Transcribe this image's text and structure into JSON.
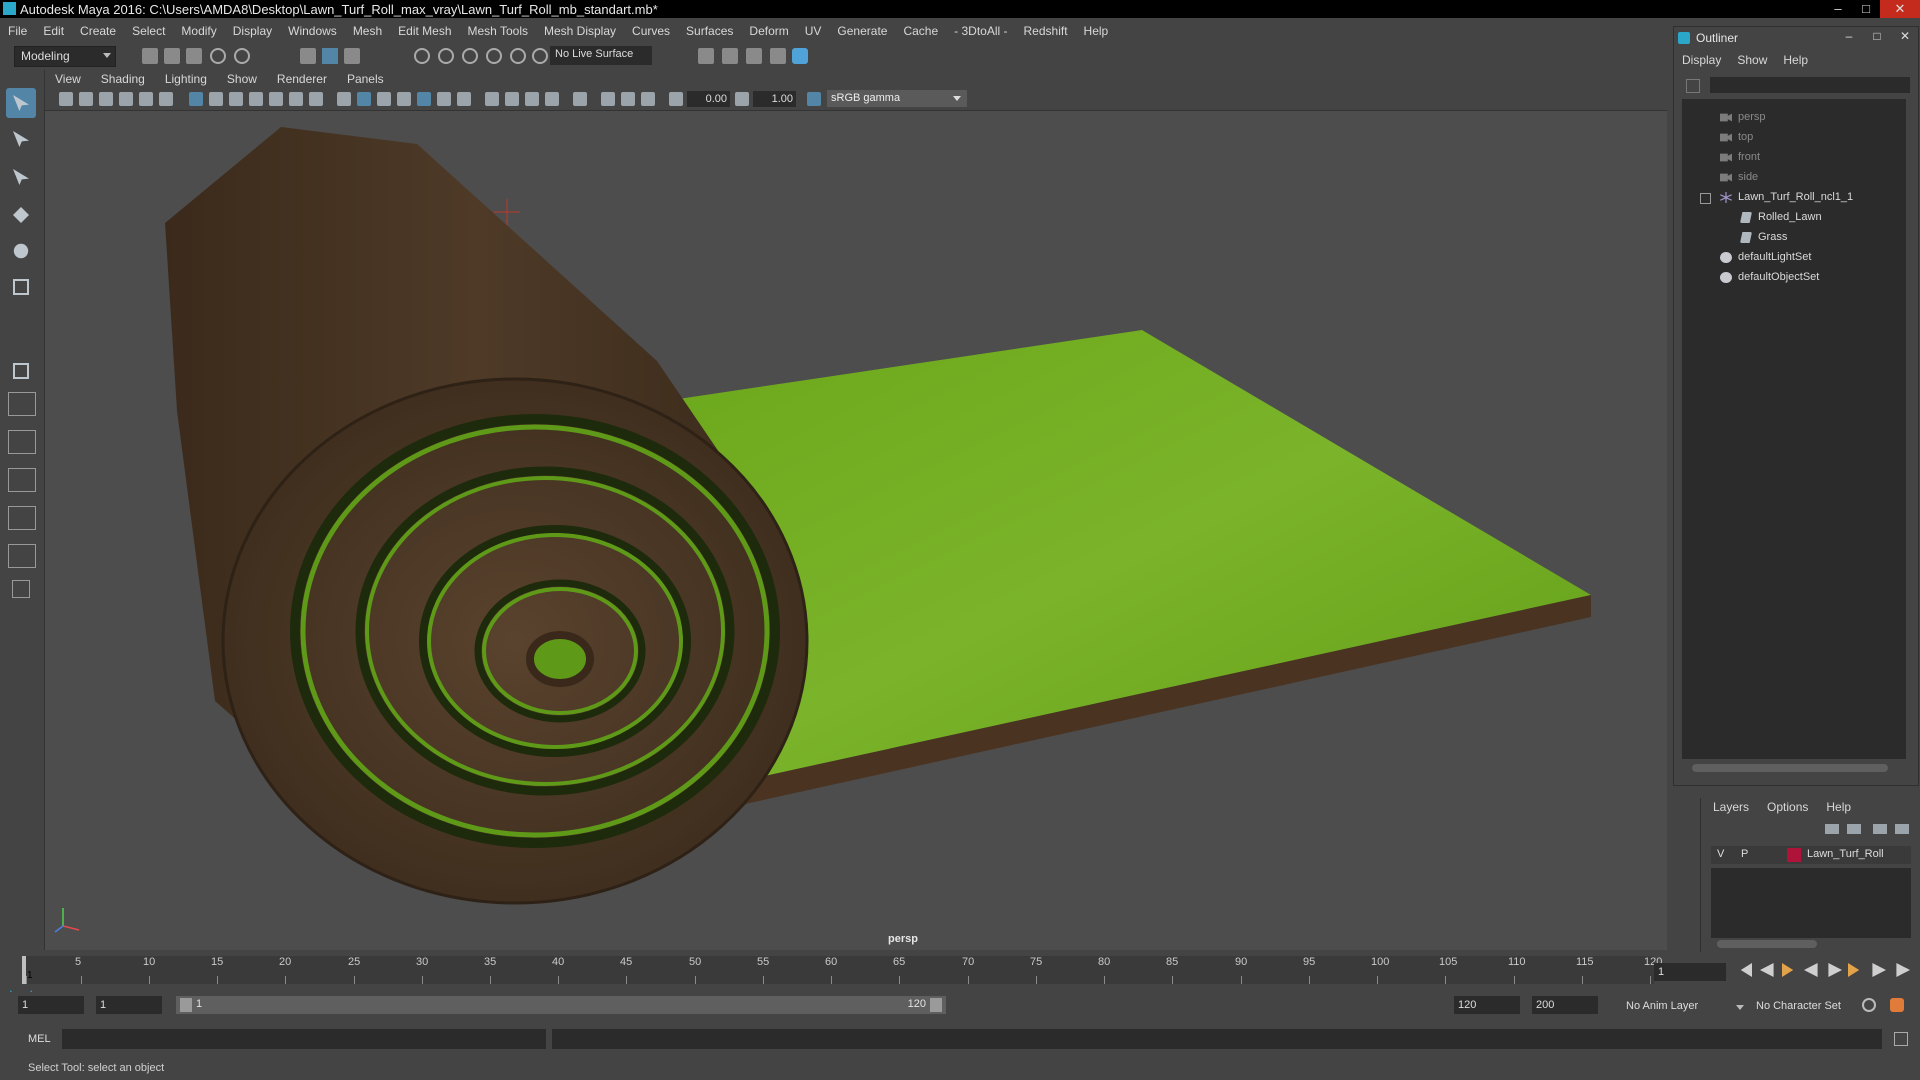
{
  "title_bar": {
    "title": "Autodesk Maya 2016: C:\\Users\\AMDA8\\Desktop\\Lawn_Turf_Roll_max_vray\\Lawn_Turf_Roll_mb_standart.mb*",
    "minimize": "–",
    "maximize": "□",
    "close": "✕"
  },
  "menu": [
    "File",
    "Edit",
    "Create",
    "Select",
    "Modify",
    "Display",
    "Windows",
    "Mesh",
    "Edit Mesh",
    "Mesh Tools",
    "Mesh Display",
    "Curves",
    "Surfaces",
    "Deform",
    "UV",
    "Generate",
    "Cache",
    "- 3DtoAll -",
    "Redshift",
    "Help"
  ],
  "status_line": {
    "menu_set": "Modeling",
    "live_surface": "No Live Surface"
  },
  "panel_menu": [
    "View",
    "Shading",
    "Lighting",
    "Show",
    "Renderer",
    "Panels"
  ],
  "panel_toolbar": {
    "exposure": "0.00",
    "gamma_value": "1.00",
    "color_space": "sRGB gamma"
  },
  "viewport": {
    "camera_label": "persp"
  },
  "outliner": {
    "title": "Outliner",
    "menu": [
      "Display",
      "Show",
      "Help"
    ],
    "nodes": [
      {
        "label": "persp",
        "kind": "camera"
      },
      {
        "label": "top",
        "kind": "camera"
      },
      {
        "label": "front",
        "kind": "camera"
      },
      {
        "label": "side",
        "kind": "camera"
      },
      {
        "label": "Lawn_Turf_Roll_ncl1_1",
        "kind": "group"
      },
      {
        "label": "Rolled_Lawn",
        "kind": "mesh"
      },
      {
        "label": "Grass",
        "kind": "mesh"
      },
      {
        "label": "defaultLightSet",
        "kind": "set"
      },
      {
        "label": "defaultObjectSet",
        "kind": "set"
      }
    ]
  },
  "layers": {
    "menu": [
      "Layers",
      "Options",
      "Help"
    ],
    "rows": [
      {
        "visible": "V",
        "playback": "P",
        "name": "Lawn_Turf_Roll",
        "color": "#b0133a"
      }
    ]
  },
  "time_slider": {
    "ticks": [
      "1",
      "5",
      "10",
      "15",
      "20",
      "25",
      "30",
      "35",
      "40",
      "45",
      "50",
      "55",
      "60",
      "65",
      "70",
      "75",
      "80",
      "85",
      "90",
      "95",
      "100",
      "105",
      "110",
      "115",
      "120"
    ],
    "current_frame": "1",
    "current_frame_field": "1"
  },
  "range_slider": {
    "start_field": "1",
    "playback_start": "1",
    "range_start_label": "1",
    "range_end_label": "120",
    "playback_end": "120",
    "end_field": "200",
    "anim_layer": "No Anim Layer",
    "character_set": "No Character Set"
  },
  "command_line": {
    "language": "MEL"
  },
  "help_line": {
    "text": "Select Tool: select an object"
  },
  "colors": {
    "accent": "#5285a6",
    "maya_blue": "#2aa7c9",
    "grass": "#6fae1d",
    "soil": "#4a3421"
  }
}
